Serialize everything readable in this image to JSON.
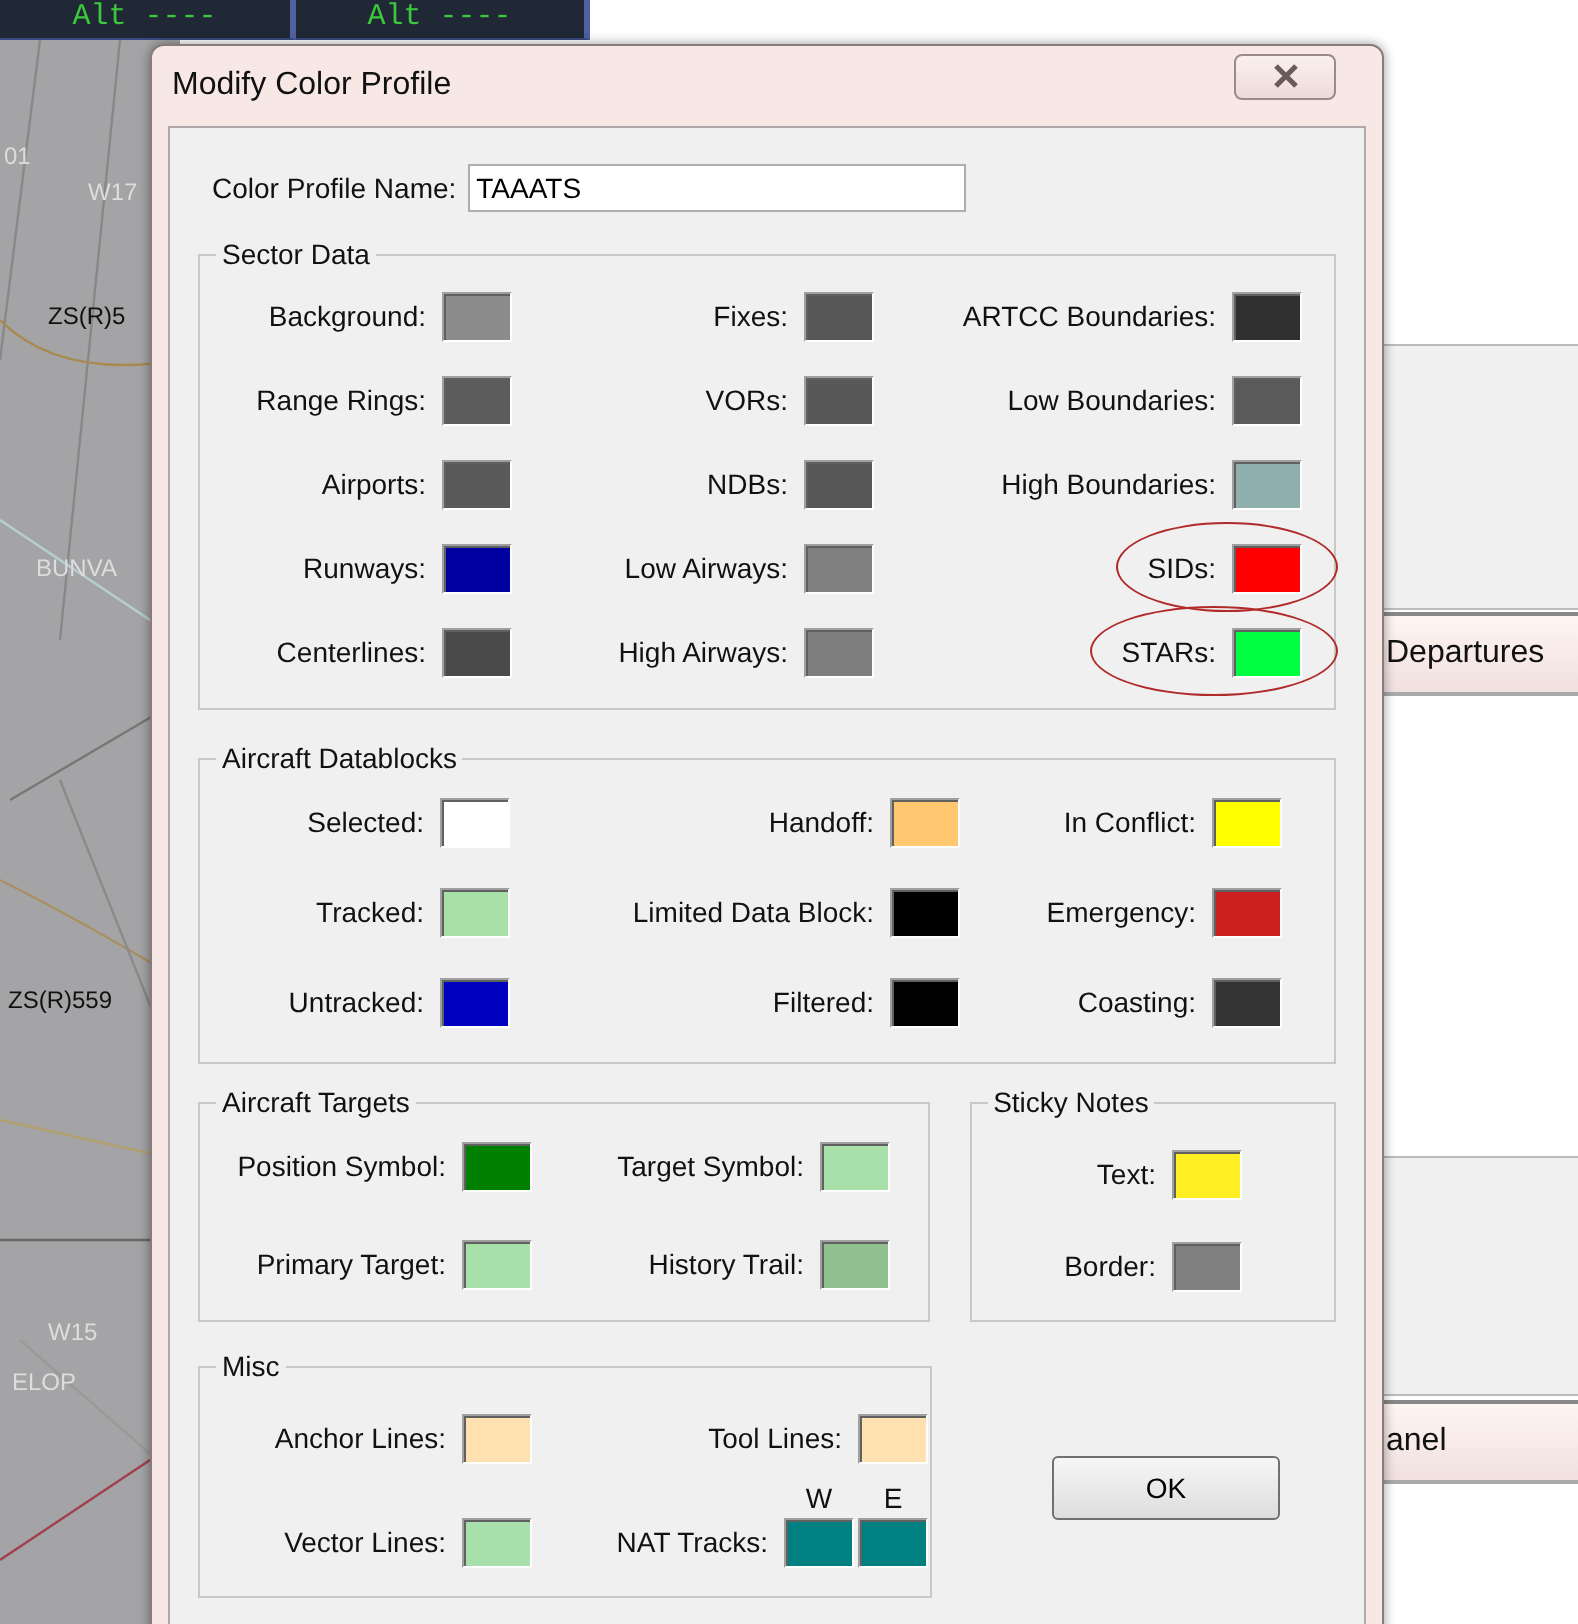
{
  "background": {
    "altitude_readouts": [
      "Alt ----",
      "Alt ----"
    ],
    "map_labels": [
      "01",
      "W17",
      "ZS(R)5",
      "BUNVA",
      "ZS(R)559",
      "W15",
      "ELOP"
    ],
    "panels": [
      {
        "title": "Departures"
      },
      {
        "title": "anel"
      }
    ]
  },
  "dialog": {
    "title": "Modify Color Profile",
    "profile_name": {
      "label": "Color Profile Name:",
      "value": "TAAATS"
    },
    "groups": [
      {
        "title": "Sector Data",
        "columns": [
          [
            {
              "kind": "swatch",
              "label": "Background:",
              "color": "#8c8c8c",
              "circled": false
            },
            {
              "kind": "swatch",
              "label": "Range Rings:",
              "color": "#5c5c5c",
              "circled": false
            },
            {
              "kind": "swatch",
              "label": "Airports:",
              "color": "#595959",
              "circled": false
            },
            {
              "kind": "swatch",
              "label": "Runways:",
              "color": "#0000a0",
              "circled": false
            },
            {
              "kind": "swatch",
              "label": "Centerlines:",
              "color": "#4a4a4a",
              "circled": false
            }
          ],
          [
            {
              "kind": "swatch",
              "label": "Fixes:",
              "color": "#585858",
              "circled": false
            },
            {
              "kind": "swatch",
              "label": "VORs:",
              "color": "#585858",
              "circled": false
            },
            {
              "kind": "swatch",
              "label": "NDBs:",
              "color": "#585858",
              "circled": false
            },
            {
              "kind": "swatch",
              "label": "Low Airways:",
              "color": "#808080",
              "circled": false
            },
            {
              "kind": "swatch",
              "label": "High Airways:",
              "color": "#7e7e7e",
              "circled": false
            }
          ],
          [
            {
              "kind": "swatch",
              "label": "ARTCC Boundaries:",
              "color": "#303030",
              "circled": false
            },
            {
              "kind": "swatch",
              "label": "Low Boundaries:",
              "color": "#5a5a5a",
              "circled": false
            },
            {
              "kind": "swatch",
              "label": "High Boundaries:",
              "color": "#90b0b0",
              "circled": false
            },
            {
              "kind": "swatch",
              "label": "SIDs:",
              "color": "#ff0000",
              "circled": true
            },
            {
              "kind": "swatch",
              "label": "STARs:",
              "color": "#00ff40",
              "circled": true
            }
          ]
        ]
      },
      {
        "title": "Aircraft Datablocks",
        "columns": [
          [
            {
              "kind": "swatch",
              "label": "Selected:",
              "color": "#ffffff",
              "circled": false
            },
            {
              "kind": "swatch",
              "label": "Tracked:",
              "color": "#a8e0a8",
              "circled": false
            },
            {
              "kind": "swatch",
              "label": "Untracked:",
              "color": "#0000c0",
              "circled": false
            }
          ],
          [
            {
              "kind": "swatch",
              "label": "Handoff:",
              "color": "#ffc870",
              "circled": false
            },
            {
              "kind": "swatch",
              "label": "Limited Data Block:",
              "color": "#000000",
              "circled": false
            },
            {
              "kind": "swatch",
              "label": "Filtered:",
              "color": "#010101",
              "circled": false
            }
          ],
          [
            {
              "kind": "swatch",
              "label": "In Conflict:",
              "color": "#ffff00",
              "circled": false
            },
            {
              "kind": "swatch",
              "label": "Emergency:",
              "color": "#cc2020",
              "circled": false
            },
            {
              "kind": "swatch",
              "label": "Coasting:",
              "color": "#333333",
              "circled": false
            }
          ]
        ]
      },
      {
        "title": "Aircraft Targets",
        "columns": [
          [
            {
              "kind": "swatch",
              "label": "Position Symbol:",
              "color": "#008000",
              "circled": false
            },
            {
              "kind": "swatch",
              "label": "Primary Target:",
              "color": "#a8e0a9",
              "circled": false
            }
          ],
          [
            {
              "kind": "swatch",
              "label": "Target Symbol:",
              "color": "#a8e0aa",
              "circled": false
            },
            {
              "kind": "swatch",
              "label": "History Trail:",
              "color": "#90c090",
              "circled": false
            }
          ]
        ]
      },
      {
        "title": "Sticky Notes",
        "columns": [
          [
            {
              "kind": "swatch",
              "label": "Text:",
              "color": "#ffee22",
              "circled": false
            },
            {
              "kind": "swatch",
              "label": "Border:",
              "color": "#808080",
              "circled": false
            }
          ]
        ]
      },
      {
        "title": "Misc",
        "columns": [
          [
            {
              "kind": "swatch",
              "label": "Anchor Lines:",
              "color": "#ffe0b0",
              "circled": false
            },
            {
              "kind": "swatch",
              "label": "Vector Lines:",
              "color": "#a8e0ab",
              "circled": false
            }
          ],
          [
            {
              "kind": "swatch",
              "label": "Tool Lines:",
              "color": "#ffe0b1",
              "circled": false
            },
            {
              "kind": "pair",
              "label": "NAT Tracks:",
              "circled": false,
              "swatches": [
                {
                  "caption": "W",
                  "color": "#008080"
                },
                {
                  "caption": "E",
                  "color": "#008081"
                }
              ]
            }
          ]
        ]
      }
    ],
    "ok_button": "OK"
  }
}
